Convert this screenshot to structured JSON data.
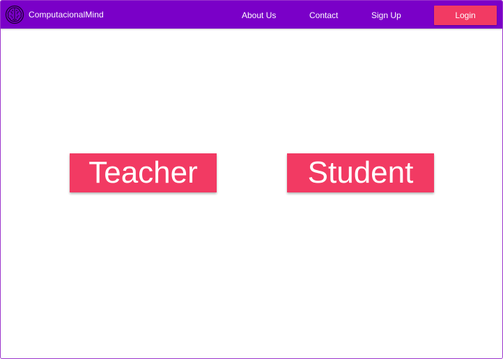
{
  "navbar": {
    "brand_name": "ComputacionalMind",
    "logo_icon": "brain-icon",
    "background_color": "#7a00c8",
    "links": {
      "about": "About Us",
      "contact": "Contact",
      "signup": "Sign Up"
    },
    "login_label": "Login",
    "login_color": "#f23a63"
  },
  "main": {
    "teacher_label": "Teacher",
    "student_label": "Student",
    "button_color": "#f23a63"
  }
}
